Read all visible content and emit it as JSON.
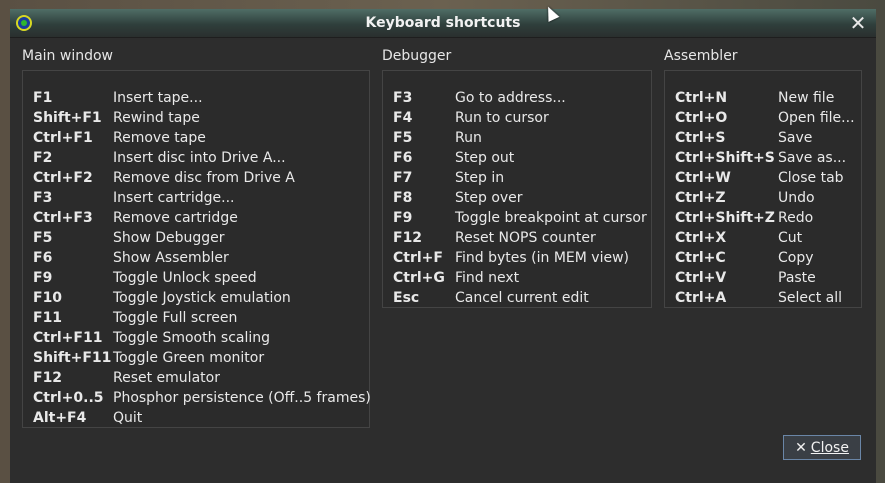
{
  "window": {
    "title": "Keyboard shortcuts",
    "close_glyph": "✕",
    "close_button_x": "✕",
    "close_button_label": "Close"
  },
  "main_window": {
    "title": "Main window",
    "rows": [
      {
        "key": "F1",
        "desc": "Insert tape..."
      },
      {
        "key": "Shift+F1",
        "desc": "Rewind tape"
      },
      {
        "key": "Ctrl+F1",
        "desc": "Remove tape"
      },
      {
        "key": "F2",
        "desc": "Insert disc into Drive A..."
      },
      {
        "key": "Ctrl+F2",
        "desc": "Remove disc from Drive A"
      },
      {
        "key": "F3",
        "desc": "Insert cartridge..."
      },
      {
        "key": "Ctrl+F3",
        "desc": "Remove cartridge"
      },
      {
        "key": "F5",
        "desc": "Show Debugger"
      },
      {
        "key": "F6",
        "desc": "Show Assembler"
      },
      {
        "key": "F9",
        "desc": "Toggle Unlock speed"
      },
      {
        "key": "F10",
        "desc": "Toggle Joystick emulation"
      },
      {
        "key": "F11",
        "desc": "Toggle Full screen"
      },
      {
        "key": "Ctrl+F11",
        "desc": "Toggle Smooth scaling"
      },
      {
        "key": "Shift+F11",
        "desc": "Toggle Green monitor"
      },
      {
        "key": "F12",
        "desc": "Reset emulator"
      },
      {
        "key": "Ctrl+0..5",
        "desc": "Phosphor persistence (Off..5 frames)"
      },
      {
        "key": "Alt+F4",
        "desc": "Quit"
      }
    ]
  },
  "debugger": {
    "title": "Debugger",
    "rows": [
      {
        "key": "F3",
        "desc": "Go to address..."
      },
      {
        "key": "F4",
        "desc": "Run to cursor"
      },
      {
        "key": "F5",
        "desc": "Run"
      },
      {
        "key": "F6",
        "desc": "Step out"
      },
      {
        "key": "F7",
        "desc": "Step in"
      },
      {
        "key": "F8",
        "desc": "Step over"
      },
      {
        "key": "F9",
        "desc": "Toggle breakpoint at cursor"
      },
      {
        "key": "F12",
        "desc": "Reset NOPS counter"
      },
      {
        "key": "Ctrl+F",
        "desc": "Find bytes (in MEM view)"
      },
      {
        "key": "Ctrl+G",
        "desc": "Find next"
      },
      {
        "key": "Esc",
        "desc": "Cancel current edit"
      }
    ]
  },
  "assembler": {
    "title": "Assembler",
    "rows": [
      {
        "key": "Ctrl+N",
        "desc": "New file"
      },
      {
        "key": "Ctrl+O",
        "desc": "Open file..."
      },
      {
        "key": "Ctrl+S",
        "desc": "Save"
      },
      {
        "key": "Ctrl+Shift+S",
        "desc": "Save as..."
      },
      {
        "key": "Ctrl+W",
        "desc": "Close tab"
      },
      {
        "key": "Ctrl+Z",
        "desc": "Undo"
      },
      {
        "key": "Ctrl+Shift+Z",
        "desc": "Redo"
      },
      {
        "key": "Ctrl+X",
        "desc": "Cut"
      },
      {
        "key": "Ctrl+C",
        "desc": "Copy"
      },
      {
        "key": "Ctrl+V",
        "desc": "Paste"
      },
      {
        "key": "Ctrl+A",
        "desc": "Select all"
      }
    ]
  }
}
